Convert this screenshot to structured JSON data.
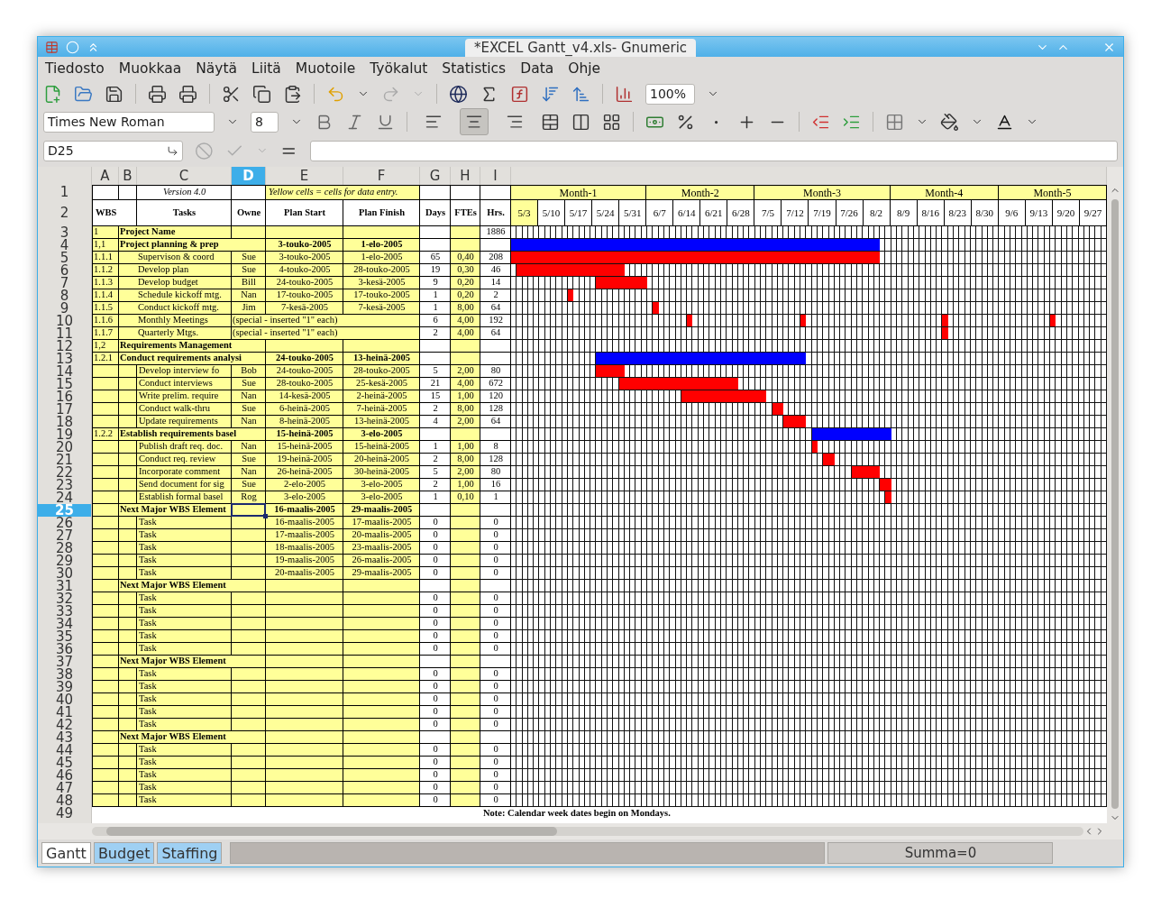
{
  "window": {
    "title": "*EXCEL Gantt_v4.xls- Gnumeric"
  },
  "menu": [
    "Tiedosto",
    "Muokkaa",
    "Näytä",
    "Liitä",
    "Muotoile",
    "Työkalut",
    "Statistics",
    "Data",
    "Ohje"
  ],
  "toolbar": {
    "zoom": "100%"
  },
  "format_bar": {
    "font": "Times New Roman",
    "size": "8",
    "align": [
      {
        "kind": "left",
        "selected": false
      },
      {
        "kind": "center",
        "selected": true
      },
      {
        "kind": "right",
        "selected": false
      }
    ]
  },
  "formula_bar": {
    "cell": "D25"
  },
  "columns": [
    {
      "label": "A",
      "selected": false
    },
    {
      "label": "B",
      "selected": false
    },
    {
      "label": "C",
      "selected": false
    },
    {
      "label": "D",
      "selected": true
    },
    {
      "label": "E",
      "selected": false
    },
    {
      "label": "F",
      "selected": false
    },
    {
      "label": "G",
      "selected": false
    },
    {
      "label": "H",
      "selected": false
    },
    {
      "label": "I",
      "selected": false
    }
  ],
  "title_row": {
    "header": "1",
    "selected": false,
    "version": "Version 4.0",
    "legend": "Yellow cells = cells for data entry."
  },
  "header_row": {
    "header": "2",
    "selected": false,
    "labels": [
      "WBS",
      "Tasks",
      "Owne",
      "Plan Start",
      "Plan Finish",
      "Days",
      "FTEs",
      "Hrs."
    ]
  },
  "months": [
    {
      "label": "Month-1",
      "weeks": [
        {
          "label": "5/3",
          "highlighted": true
        },
        {
          "label": "5/10",
          "highlighted": false
        },
        {
          "label": "5/17",
          "highlighted": false
        },
        {
          "label": "5/24",
          "highlighted": false
        },
        {
          "label": "5/31",
          "highlighted": false
        }
      ]
    },
    {
      "label": "Month-2",
      "weeks": [
        {
          "label": "6/7",
          "highlighted": false
        },
        {
          "label": "6/14",
          "highlighted": false
        },
        {
          "label": "6/21",
          "highlighted": false
        },
        {
          "label": "6/28",
          "highlighted": false
        }
      ]
    },
    {
      "label": "Month-3",
      "weeks": [
        {
          "label": "7/5",
          "highlighted": false
        },
        {
          "label": "7/12",
          "highlighted": false
        },
        {
          "label": "7/19",
          "highlighted": false
        },
        {
          "label": "7/26",
          "highlighted": false
        },
        {
          "label": "8/2",
          "highlighted": false
        }
      ]
    },
    {
      "label": "Month-4",
      "weeks": [
        {
          "label": "8/9",
          "highlighted": false
        },
        {
          "label": "8/16",
          "highlighted": false
        },
        {
          "label": "8/23",
          "highlighted": false
        },
        {
          "label": "8/30",
          "highlighted": false
        }
      ]
    },
    {
      "label": "Month-5",
      "weeks": [
        {
          "label": "9/6",
          "highlighted": false
        },
        {
          "label": "9/13",
          "highlighted": false
        },
        {
          "label": "9/20",
          "highlighted": false
        },
        {
          "label": "9/27",
          "highlighted": false
        }
      ]
    }
  ],
  "rows": [
    {
      "header": "3",
      "selected": false,
      "kind": "project",
      "wbs": "1",
      "name": "Project Name",
      "hrs": "1886"
    },
    {
      "header": "4",
      "selected": false,
      "kind": "summary",
      "wbs": "1,1",
      "name": "Project planning & prep",
      "start": "3-touko-2005",
      "finish": "1-elo-2005"
    },
    {
      "header": "5",
      "selected": false,
      "kind": "task",
      "wbs": "1.1.1",
      "name": "Supervison & coord",
      "owner": "Sue",
      "start": "3-touko-2005",
      "finish": "1-elo-2005",
      "days": "65",
      "ftes": "0,40",
      "hrs": "208"
    },
    {
      "header": "6",
      "selected": false,
      "kind": "task",
      "wbs": "1.1.2",
      "name": "Develop plan",
      "owner": "Sue",
      "start": "4-touko-2005",
      "finish": "28-touko-2005",
      "days": "19",
      "ftes": "0,30",
      "hrs": "46"
    },
    {
      "header": "7",
      "selected": false,
      "kind": "task",
      "wbs": "1.1.3",
      "name": "Develop budget",
      "owner": "Bill",
      "start": "24-touko-2005",
      "finish": "3-kesä-2005",
      "days": "9",
      "ftes": "0,20",
      "hrs": "14"
    },
    {
      "header": "8",
      "selected": false,
      "kind": "task",
      "wbs": "1.1.4",
      "name": "Schedule kickoff mtg.",
      "owner": "Nan",
      "start": "17-touko-2005",
      "finish": "17-touko-2005",
      "days": "1",
      "ftes": "0,20",
      "hrs": "2"
    },
    {
      "header": "9",
      "selected": false,
      "kind": "task",
      "wbs": "1.1.5",
      "name": "Conduct kickoff mtg.",
      "owner": "Jim",
      "start": "7-kesä-2005",
      "finish": "7-kesä-2005",
      "days": "1",
      "ftes": "8,00",
      "hrs": "64"
    },
    {
      "header": "10",
      "selected": false,
      "kind": "note",
      "wbs": "1.1.6",
      "name": "Monthly Meetings",
      "note": "(special - inserted \"1\" each)",
      "days": "6",
      "ftes": "4,00",
      "hrs": "192"
    },
    {
      "header": "11",
      "selected": false,
      "kind": "note",
      "wbs": "1.1.7",
      "name": "Quarterly Mtgs.",
      "note": "(special - inserted \"1\" each)",
      "days": "2",
      "ftes": "4,00",
      "hrs": "64"
    },
    {
      "header": "12",
      "selected": false,
      "kind": "group",
      "wbs": "1,2",
      "name": "Requirements Management"
    },
    {
      "header": "13",
      "selected": false,
      "kind": "summary",
      "wbs": "1.2.1",
      "name": "Conduct requirements analysi",
      "start": "24-touko-2005",
      "finish": "13-heinä-2005"
    },
    {
      "header": "14",
      "selected": false,
      "kind": "task",
      "name": "Develop interview fo",
      "owner": "Bob",
      "start": "24-touko-2005",
      "finish": "28-touko-2005",
      "days": "5",
      "ftes": "2,00",
      "hrs": "80"
    },
    {
      "header": "15",
      "selected": false,
      "kind": "task",
      "name": "Conduct interviews",
      "owner": "Sue",
      "start": "28-touko-2005",
      "finish": "25-kesä-2005",
      "days": "21",
      "ftes": "4,00",
      "hrs": "672"
    },
    {
      "header": "16",
      "selected": false,
      "kind": "task",
      "name": "Write prelim. require",
      "owner": "Nan",
      "start": "14-kesä-2005",
      "finish": "2-heinä-2005",
      "days": "15",
      "ftes": "1,00",
      "hrs": "120"
    },
    {
      "header": "17",
      "selected": false,
      "kind": "task",
      "name": "Conduct walk-thru",
      "owner": "Sue",
      "start": "6-heinä-2005",
      "finish": "7-heinä-2005",
      "days": "2",
      "ftes": "8,00",
      "hrs": "128"
    },
    {
      "header": "18",
      "selected": false,
      "kind": "task",
      "name": "Update requirements",
      "owner": "Nan",
      "start": "8-heinä-2005",
      "finish": "13-heinä-2005",
      "days": "4",
      "ftes": "2,00",
      "hrs": "64"
    },
    {
      "header": "19",
      "selected": false,
      "kind": "summary",
      "wbs": "1.2.2",
      "name": "Establish requirements basel",
      "start": "15-heinä-2005",
      "finish": "3-elo-2005"
    },
    {
      "header": "20",
      "selected": false,
      "kind": "task",
      "name": "Publish draft req. doc.",
      "owner": "Nan",
      "start": "15-heinä-2005",
      "finish": "15-heinä-2005",
      "days": "1",
      "ftes": "1,00",
      "hrs": "8"
    },
    {
      "header": "21",
      "selected": false,
      "kind": "task",
      "name": "Conduct req. review",
      "owner": "Sue",
      "start": "19-heinä-2005",
      "finish": "20-heinä-2005",
      "days": "2",
      "ftes": "8,00",
      "hrs": "128"
    },
    {
      "header": "22",
      "selected": false,
      "kind": "task",
      "name": "Incorporate comment",
      "owner": "Nan",
      "start": "26-heinä-2005",
      "finish": "30-heinä-2005",
      "days": "5",
      "ftes": "2,00",
      "hrs": "80"
    },
    {
      "header": "23",
      "selected": false,
      "kind": "task",
      "name": "Send document for sig",
      "owner": "Sue",
      "start": "2-elo-2005",
      "finish": "3-elo-2005",
      "days": "2",
      "ftes": "1,00",
      "hrs": "16"
    },
    {
      "header": "24",
      "selected": false,
      "kind": "task",
      "name": "Establish formal basel",
      "owner": "Rog",
      "start": "3-elo-2005",
      "finish": "3-elo-2005",
      "days": "1",
      "ftes": "0,10",
      "hrs": "1"
    },
    {
      "header": "25",
      "selected": true,
      "kind": "summary",
      "name": "Next Major WBS Element",
      "start": "16-maalis-2005",
      "finish": "29-maalis-2005"
    },
    {
      "header": "26",
      "selected": false,
      "kind": "task",
      "name": "Task",
      "start": "16-maalis-2005",
      "finish": "17-maalis-2005",
      "days": "0",
      "hrs": "0"
    },
    {
      "header": "27",
      "selected": false,
      "kind": "task",
      "name": "Task",
      "start": "17-maalis-2005",
      "finish": "20-maalis-2005",
      "days": "0",
      "hrs": "0"
    },
    {
      "header": "28",
      "selected": false,
      "kind": "task",
      "name": "Task",
      "start": "18-maalis-2005",
      "finish": "23-maalis-2005",
      "days": "0",
      "hrs": "0"
    },
    {
      "header": "29",
      "selected": false,
      "kind": "task",
      "name": "Task",
      "start": "19-maalis-2005",
      "finish": "26-maalis-2005",
      "days": "0",
      "hrs": "0"
    },
    {
      "header": "30",
      "selected": false,
      "kind": "task",
      "name": "Task",
      "start": "20-maalis-2005",
      "finish": "29-maalis-2005",
      "days": "0",
      "hrs": "0"
    },
    {
      "header": "31",
      "selected": false,
      "kind": "group",
      "name": "Next Major WBS Element"
    },
    {
      "header": "32",
      "selected": false,
      "kind": "task",
      "name": "Task",
      "days": "0",
      "hrs": "0"
    },
    {
      "header": "33",
      "selected": false,
      "kind": "task",
      "name": "Task",
      "days": "0",
      "hrs": "0"
    },
    {
      "header": "34",
      "selected": false,
      "kind": "task",
      "name": "Task",
      "days": "0",
      "hrs": "0"
    },
    {
      "header": "35",
      "selected": false,
      "kind": "task",
      "name": "Task",
      "days": "0",
      "hrs": "0"
    },
    {
      "header": "36",
      "selected": false,
      "kind": "task",
      "name": "Task",
      "days": "0",
      "hrs": "0"
    },
    {
      "header": "37",
      "selected": false,
      "kind": "group",
      "name": "Next Major WBS Element"
    },
    {
      "header": "38",
      "selected": false,
      "kind": "task",
      "name": "Task",
      "days": "0",
      "hrs": "0"
    },
    {
      "header": "39",
      "selected": false,
      "kind": "task",
      "name": "Task",
      "days": "0",
      "hrs": "0"
    },
    {
      "header": "40",
      "selected": false,
      "kind": "task",
      "name": "Task",
      "days": "0",
      "hrs": "0"
    },
    {
      "header": "41",
      "selected": false,
      "kind": "task",
      "name": "Task",
      "days": "0",
      "hrs": "0"
    },
    {
      "header": "42",
      "selected": false,
      "kind": "task",
      "name": "Task",
      "days": "0",
      "hrs": "0"
    },
    {
      "header": "43",
      "selected": false,
      "kind": "group",
      "name": "Next Major WBS Element"
    },
    {
      "header": "44",
      "selected": false,
      "kind": "task",
      "name": "Task",
      "days": "0",
      "hrs": "0"
    },
    {
      "header": "45",
      "selected": false,
      "kind": "task",
      "name": "Task",
      "days": "0",
      "hrs": "0"
    },
    {
      "header": "46",
      "selected": false,
      "kind": "task",
      "name": "Task",
      "days": "0",
      "hrs": "0"
    },
    {
      "header": "47",
      "selected": false,
      "kind": "task",
      "name": "Task",
      "days": "0",
      "hrs": "0"
    },
    {
      "header": "48",
      "selected": false,
      "kind": "task",
      "name": "Task",
      "days": "0",
      "hrs": "0"
    }
  ],
  "note_row": {
    "header": "49",
    "selected": false,
    "note": "Note: Calendar week dates begin on Mondays."
  },
  "sheet_tabs": [
    {
      "label": "Gantt",
      "selected": true
    },
    {
      "label": "Budget",
      "selected": false
    },
    {
      "label": "Staffing",
      "selected": false
    }
  ],
  "status": "Summa=0"
}
